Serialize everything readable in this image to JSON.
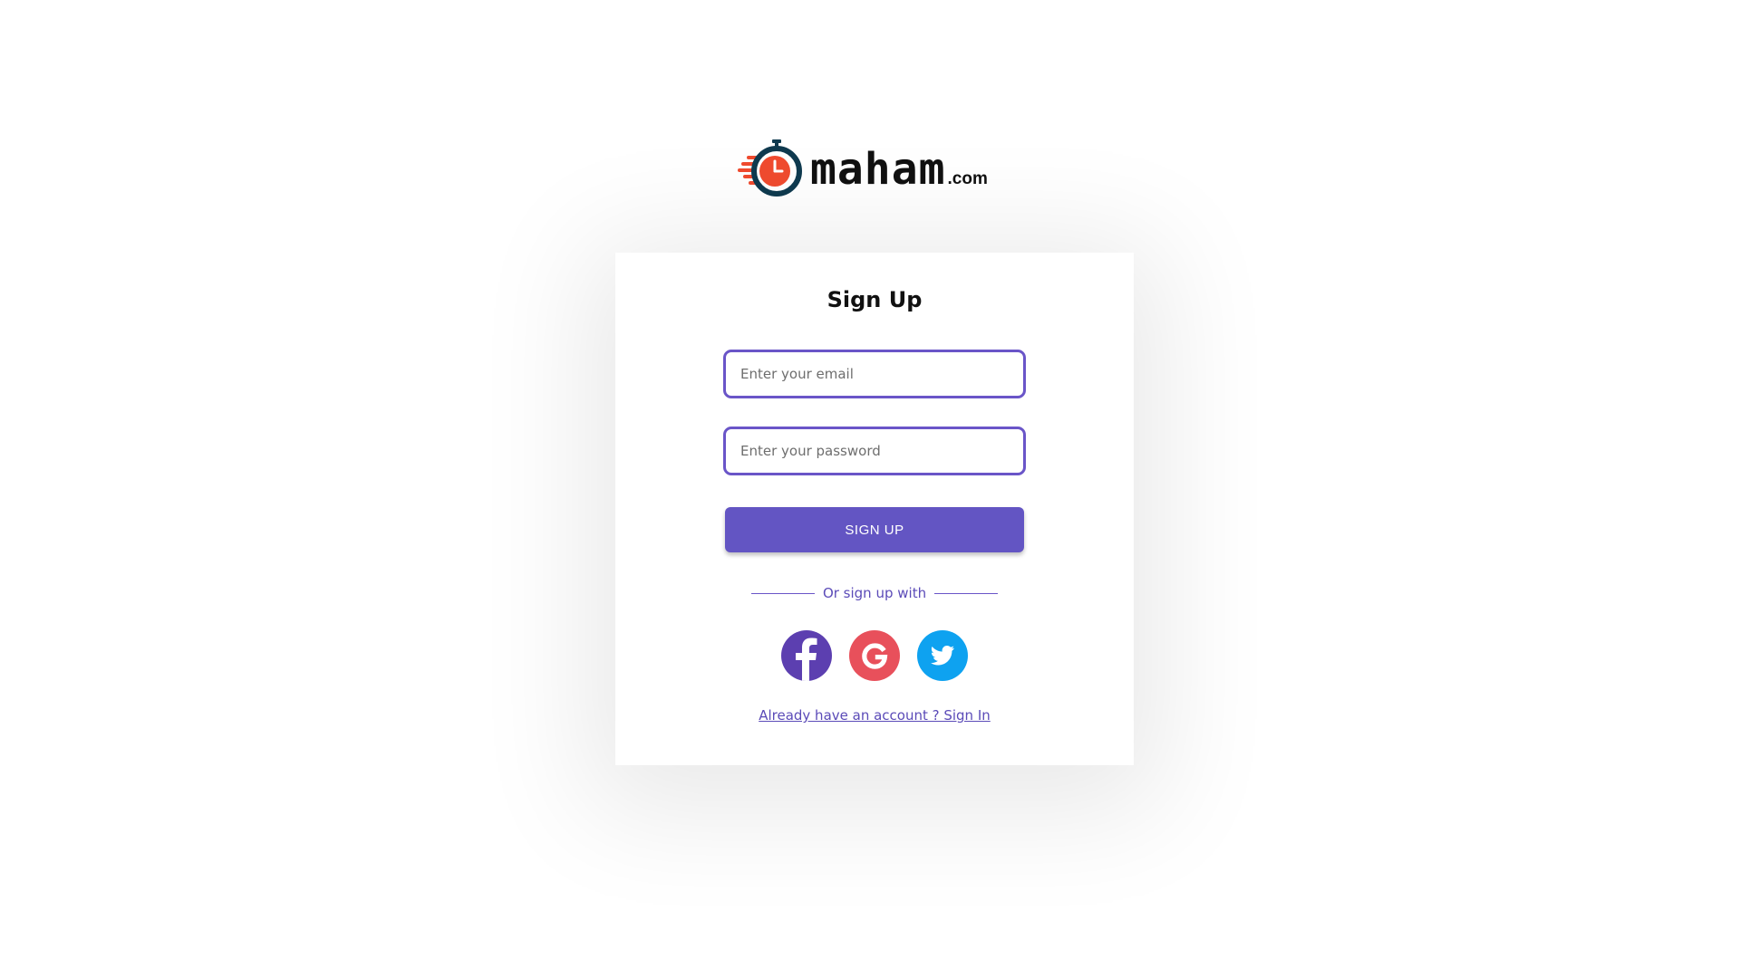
{
  "logo": {
    "brand": "maham",
    "tld": ".com",
    "icon": "stopwatch-icon"
  },
  "form": {
    "title": "Sign Up",
    "email_placeholder": "Enter your email",
    "password_placeholder": "Enter your password",
    "submit_label": "SIGN UP",
    "divider_text": "Or sign up with",
    "signin_link": "Already have an account ? Sign In"
  },
  "socials": [
    {
      "name": "facebook",
      "icon": "facebook-icon",
      "color": "#5c3fb0"
    },
    {
      "name": "google",
      "icon": "google-icon",
      "color": "#e8505b"
    },
    {
      "name": "twitter",
      "icon": "twitter-icon",
      "color": "#0ea2f0"
    }
  ],
  "colors": {
    "accent": "#6355c3",
    "input_border": "#6a55c8",
    "link": "#5b4bb8",
    "logo_orange": "#f04b2f",
    "logo_navy": "#0f3a4f"
  }
}
